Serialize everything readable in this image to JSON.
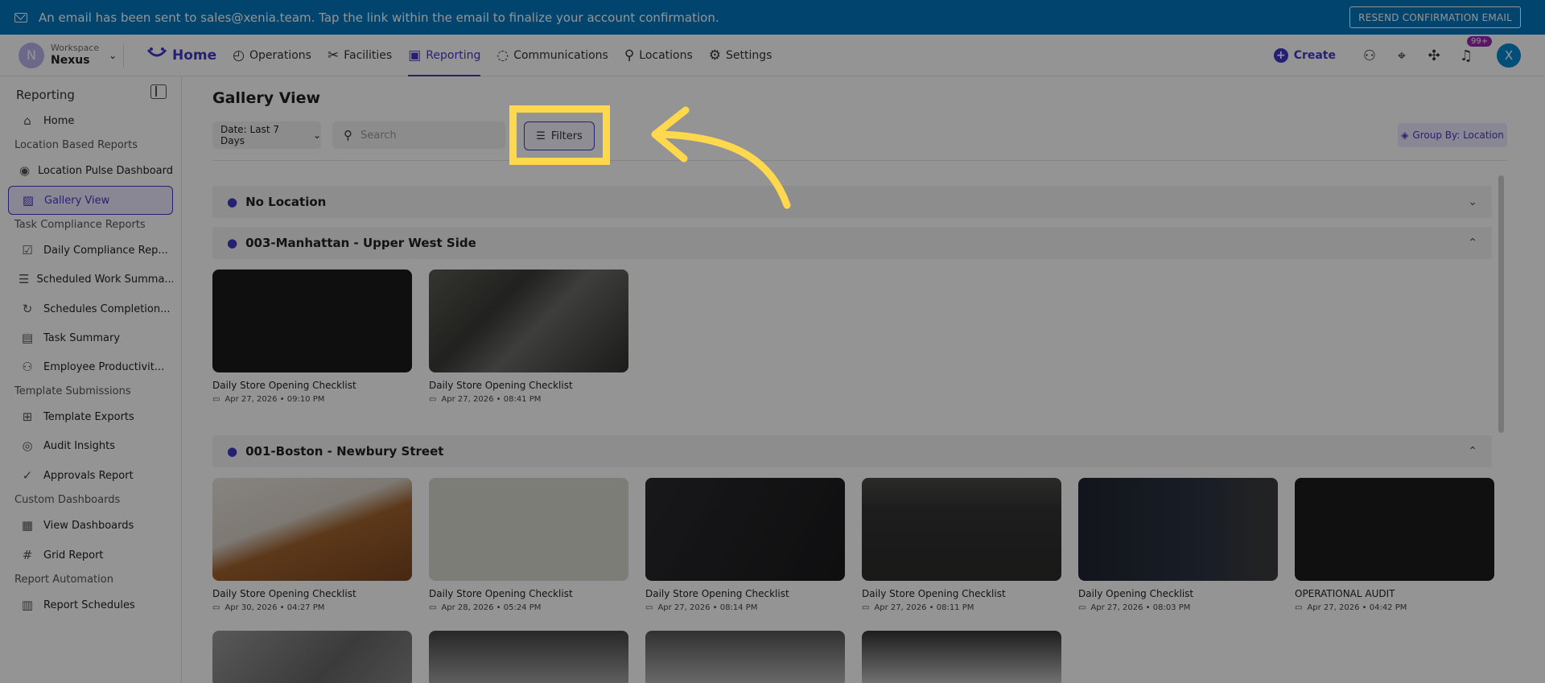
{
  "banner": {
    "message": "An email has been sent to sales@xenia.team. Tap the link within the email to finalize your account confirmation.",
    "resend_label": "RESEND CONFIRMATION EMAIL"
  },
  "workspace": {
    "initial": "N",
    "label": "Workspace",
    "name": "Nexus"
  },
  "nav": {
    "home": "Home",
    "items": [
      "Operations",
      "Facilities",
      "Reporting",
      "Communications",
      "Locations",
      "Settings"
    ],
    "active": "Reporting",
    "create_label": "Create",
    "notifications_badge": "99+",
    "user_initial": "X"
  },
  "sidebar": {
    "title": "Reporting",
    "home": "Home",
    "sections": {
      "location": "Location Based Reports",
      "task": "Task Compliance Reports",
      "template": "Template Submissions",
      "custom": "Custom Dashboards",
      "automation": "Report Automation"
    },
    "items": {
      "pulse": "Location Pulse Dashboard",
      "gallery": "Gallery View",
      "daily": "Daily Compliance Rep...",
      "scheduled": "Scheduled Work Summa...",
      "schedules": "Schedules Completion...",
      "task_summary": "Task Summary",
      "employee": "Employee Productivit...",
      "exports": "Template Exports",
      "audit": "Audit Insights",
      "approvals": "Approvals Report",
      "dashboards": "View Dashboards",
      "grid": "Grid Report",
      "schedules_rep": "Report Schedules"
    }
  },
  "main": {
    "title": "Gallery View",
    "date_filter": "Date: Last 7 Days",
    "search_placeholder": "Search",
    "filters_label": "Filters",
    "group_by_label": "Group By: Location",
    "groups": [
      {
        "name": "No Location",
        "expanded": false
      },
      {
        "name": "003-Manhattan - Upper West Side",
        "expanded": true,
        "cards": [
          {
            "title": "Daily Store Opening Checklist",
            "date": "Apr 27, 2026 • 09:10 PM"
          },
          {
            "title": "Daily Store Opening Checklist",
            "date": "Apr 27, 2026 • 08:41 PM"
          }
        ]
      },
      {
        "name": "001-Boston - Newbury Street",
        "expanded": true,
        "cards": [
          {
            "title": "Daily Store Opening Checklist",
            "date": "Apr 30, 2026 • 04:27 PM"
          },
          {
            "title": "Daily Store Opening Checklist",
            "date": "Apr 28, 2026 • 05:24 PM"
          },
          {
            "title": "Daily Store Opening Checklist",
            "date": "Apr 27, 2026 • 08:14 PM"
          },
          {
            "title": "Daily Store Opening Checklist",
            "date": "Apr 27, 2026 • 08:11 PM"
          },
          {
            "title": "Daily Opening Checklist",
            "date": "Apr 27, 2026 • 08:03 PM"
          },
          {
            "title": "OPERATIONAL AUDIT",
            "date": "Apr 27, 2026 • 04:42 PM"
          }
        ]
      }
    ]
  },
  "colors": {
    "banner": "#0277BD",
    "accent": "#4338CA",
    "highlight": "#FFD84D",
    "badge": "#9C27B0"
  }
}
